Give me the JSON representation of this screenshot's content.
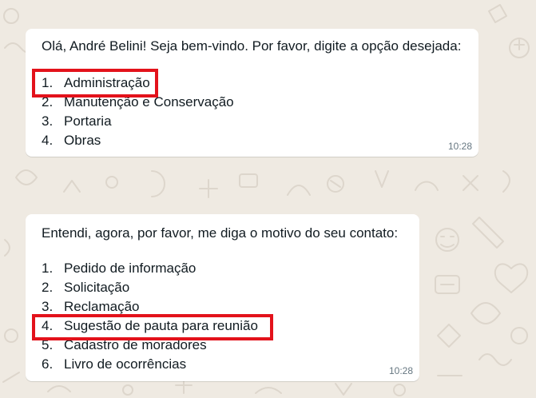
{
  "theme": {
    "chat_background": "#efeae2",
    "bubble_color": "#ffffff",
    "highlight_color": "#e3121b",
    "timestamp_color": "#667781"
  },
  "messages": [
    {
      "intro": "Olá, André Belini! Seja bem-vindo. Por favor, digite a opção desejada:",
      "options": [
        {
          "num": "1.",
          "text": "Administração",
          "highlighted": true
        },
        {
          "num": "2.",
          "text": "Manutenção e Conservação"
        },
        {
          "num": "3.",
          "text": "Portaria"
        },
        {
          "num": "4.",
          "text": "Obras"
        }
      ],
      "time": "10:28"
    },
    {
      "intro": "Entendi, agora, por favor, me diga o motivo do seu contato:",
      "options": [
        {
          "num": "1.",
          "text": "Pedido de informação"
        },
        {
          "num": "2.",
          "text": "Solicitação"
        },
        {
          "num": "3.",
          "text": "Reclamação"
        },
        {
          "num": "4.",
          "text": "Sugestão de pauta para reunião",
          "highlighted": true
        },
        {
          "num": "5.",
          "text": "Cadastro de moradores"
        },
        {
          "num": "6.",
          "text": "Livro de ocorrências"
        }
      ],
      "time": "10:28"
    }
  ]
}
